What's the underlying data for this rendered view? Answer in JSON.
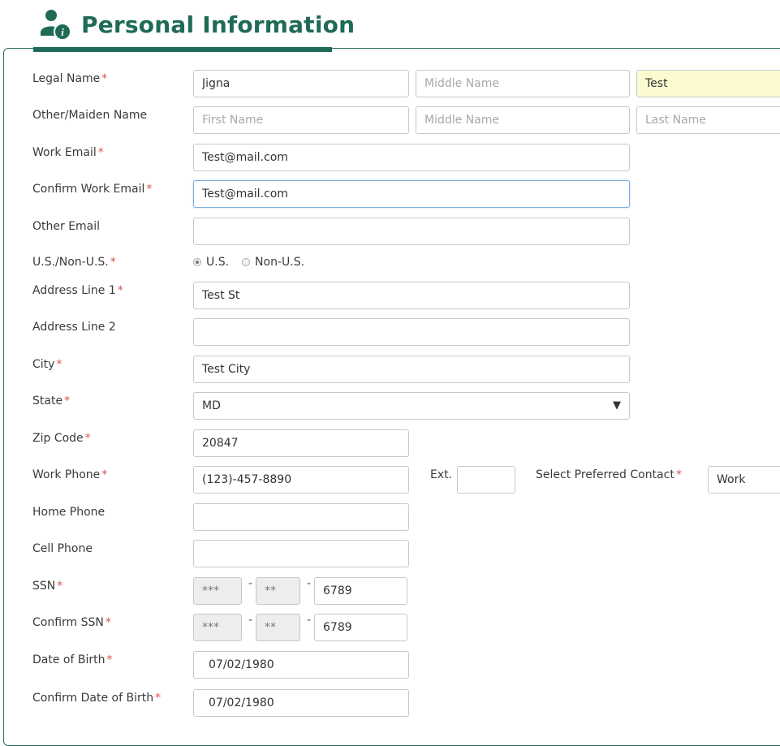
{
  "header": {
    "title": "Personal Information",
    "icon": "user-info-icon"
  },
  "colors": {
    "brand": "#1f6b57",
    "required": "#d9534f",
    "highlight": "#fbfbcf"
  },
  "fields": {
    "legal_name": {
      "label": "Legal Name",
      "first": "Jigna",
      "middle_placeholder": "Middle Name",
      "last": "Test"
    },
    "other_name": {
      "label": "Other/Maiden Name",
      "first_placeholder": "First Name",
      "middle_placeholder": "Middle Name",
      "last_placeholder": "Last Name"
    },
    "work_email": {
      "label": "Work Email",
      "value": "Test@mail.com"
    },
    "confirm_work_email": {
      "label": "Confirm Work Email",
      "value": "Test@mail.com"
    },
    "other_email": {
      "label": "Other Email",
      "value": ""
    },
    "us_non_us": {
      "label": "U.S./Non-U.S.",
      "options": [
        "U.S.",
        "Non-U.S."
      ],
      "selected": "U.S."
    },
    "address1": {
      "label": "Address Line 1",
      "value": "Test St"
    },
    "address2": {
      "label": "Address Line 2",
      "value": ""
    },
    "city": {
      "label": "City",
      "value": "Test City"
    },
    "state": {
      "label": "State",
      "value": "MD"
    },
    "zip": {
      "label": "Zip Code",
      "value": "20847"
    },
    "work_phone": {
      "label": "Work Phone",
      "value": "(123)-457-8890",
      "ext_label": "Ext.",
      "ext_value": "",
      "preferred_label": "Select Preferred Contact",
      "preferred_value": "Work"
    },
    "home_phone": {
      "label": "Home Phone",
      "value": ""
    },
    "cell_phone": {
      "label": "Cell Phone",
      "value": ""
    },
    "ssn": {
      "label": "SSN",
      "part1": "***",
      "part2": "**",
      "part3": "6789"
    },
    "confirm_ssn": {
      "label": "Confirm SSN",
      "part1": "***",
      "part2": "**",
      "part3": "6789"
    },
    "dob": {
      "label": "Date of Birth",
      "value": "07/02/1980"
    },
    "confirm_dob": {
      "label": "Confirm Date of Birth",
      "value": "07/02/1980"
    }
  },
  "required_mark": "*",
  "dash": "-",
  "caret": "▼"
}
